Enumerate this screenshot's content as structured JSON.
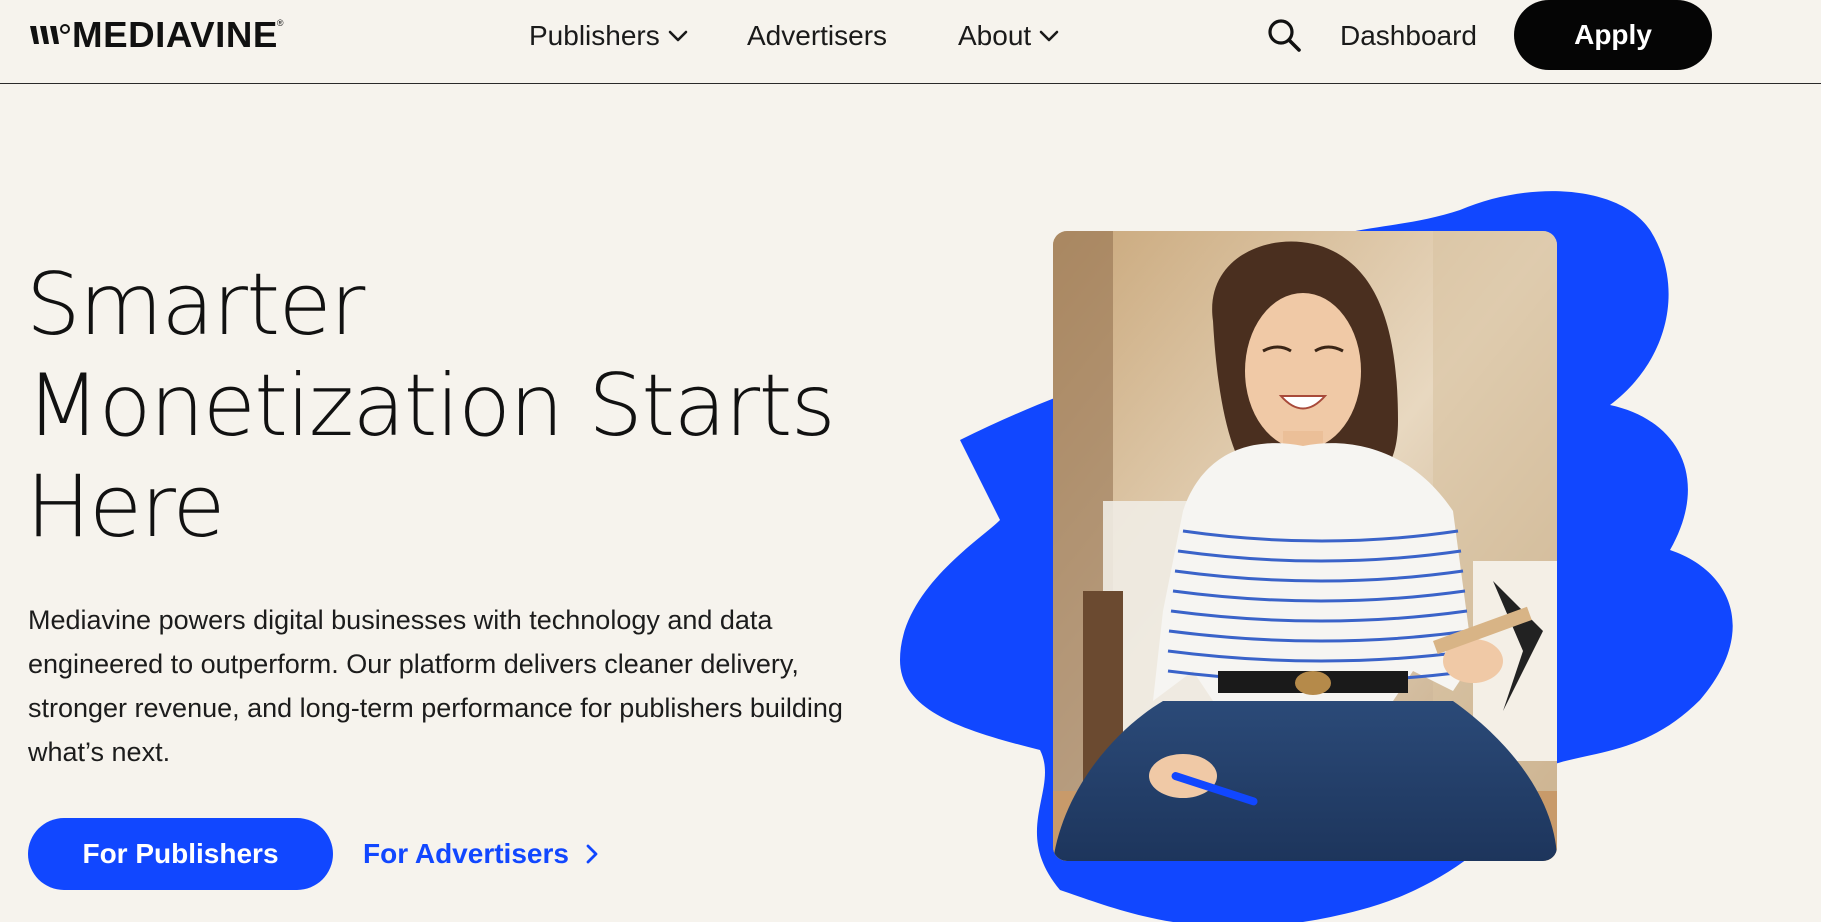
{
  "brand": {
    "name": "MEDIAVINE",
    "registered_mark": "®",
    "primary_color": "#1147ff",
    "dark_color": "#050505",
    "background_color": "#f6f3ed"
  },
  "header": {
    "nav": [
      {
        "label": "Publishers",
        "has_dropdown": true
      },
      {
        "label": "Advertisers",
        "has_dropdown": false
      },
      {
        "label": "About",
        "has_dropdown": true
      }
    ],
    "search_icon": "search-icon",
    "dashboard_label": "Dashboard",
    "apply_label": "Apply"
  },
  "hero": {
    "title_lines": [
      "Smarter",
      "Monetization Starts",
      "Here"
    ],
    "description": "Mediavine powers digital businesses with technology and data engineered to outperform. Our platform delivers cleaner delivery, stronger revenue, and long-term performance for publishers building what’s next.",
    "primary_cta": "For Publishers",
    "secondary_cta": "For Advertisers",
    "secondary_cta_icon": "chevron-right-icon"
  }
}
